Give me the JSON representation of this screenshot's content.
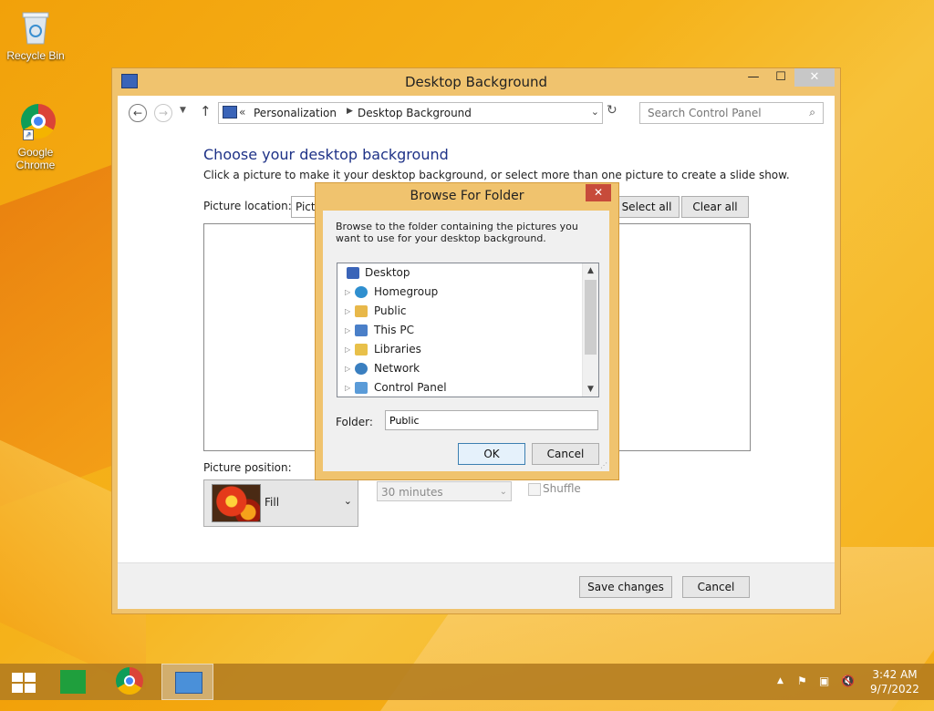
{
  "desktop": {
    "icons": [
      {
        "label": "Recycle Bin",
        "icon": "recycle-bin-icon"
      },
      {
        "label": "Google Chrome",
        "icon": "chrome-icon"
      }
    ]
  },
  "window": {
    "title": "Desktop Background",
    "controls": {
      "minimize": "—",
      "maximize": "☐",
      "close": "✕"
    },
    "address": {
      "separator": "«",
      "crumbs": [
        "Personalization",
        "Desktop Background"
      ]
    },
    "search": {
      "placeholder": "Search Control Panel"
    },
    "heading": "Choose your desktop background",
    "subtext": "Click a picture to make it your desktop background, or select more than one picture to create a slide show.",
    "picture_location_label": "Picture location:",
    "picture_location_value": "Pictures Library",
    "select_all": "Select all",
    "clear_all": "Clear all",
    "picture_position_label": "Picture position:",
    "picture_position_value": "Fill",
    "interval_value": "30 minutes",
    "shuffle_label": "Shuffle",
    "save_changes": "Save changes",
    "cancel": "Cancel"
  },
  "dialog": {
    "title": "Browse For Folder",
    "close": "✕",
    "description": "Browse to the folder containing the pictures you want to use for your desktop background.",
    "tree": [
      {
        "label": "Desktop",
        "icon": "desktop-icon",
        "color": "#3a64b8"
      },
      {
        "label": "Homegroup",
        "icon": "homegroup-icon",
        "color": "#2f8fcf"
      },
      {
        "label": "Public",
        "icon": "user-folder-icon",
        "color": "#e8b84a"
      },
      {
        "label": "This PC",
        "icon": "computer-icon",
        "color": "#4a7fc8"
      },
      {
        "label": "Libraries",
        "icon": "libraries-icon",
        "color": "#e8c04a"
      },
      {
        "label": "Network",
        "icon": "network-icon",
        "color": "#3a7fc0"
      },
      {
        "label": "Control Panel",
        "icon": "control-panel-icon",
        "color": "#5a9bd8"
      }
    ],
    "folder_label": "Folder:",
    "folder_value": "Public",
    "ok": "OK",
    "cancel": "Cancel"
  },
  "taskbar": {
    "items": [
      "start",
      "store",
      "chrome",
      "control-panel"
    ],
    "clock": {
      "time": "3:42 AM",
      "date": "9/7/2022"
    }
  }
}
